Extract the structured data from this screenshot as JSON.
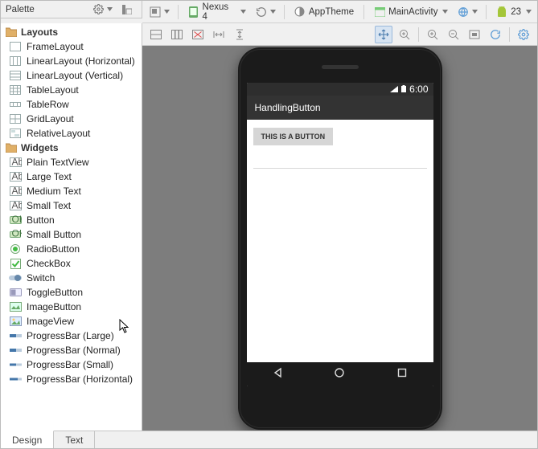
{
  "toolbar": {
    "device": "Nexus 4",
    "theme_label": "AppTheme",
    "activity_label": "MainActivity",
    "api": "23"
  },
  "palette": {
    "title": "Palette",
    "categories": {
      "layouts": {
        "label": "Layouts",
        "items": [
          "FrameLayout",
          "LinearLayout (Horizontal)",
          "LinearLayout (Vertical)",
          "TableLayout",
          "TableRow",
          "GridLayout",
          "RelativeLayout"
        ]
      },
      "widgets": {
        "label": "Widgets",
        "items": [
          "Plain TextView",
          "Large Text",
          "Medium Text",
          "Small Text",
          "Button",
          "Small Button",
          "RadioButton",
          "CheckBox",
          "Switch",
          "ToggleButton",
          "ImageButton",
          "ImageView",
          "ProgressBar (Large)",
          "ProgressBar (Normal)",
          "ProgressBar (Small)",
          "ProgressBar (Horizontal)"
        ]
      }
    }
  },
  "preview": {
    "status_time": "6:00",
    "app_title": "HandlingButton",
    "button_text": "THIS IS A BUTTON"
  },
  "bottom_tabs": {
    "design": "Design",
    "text": "Text"
  }
}
